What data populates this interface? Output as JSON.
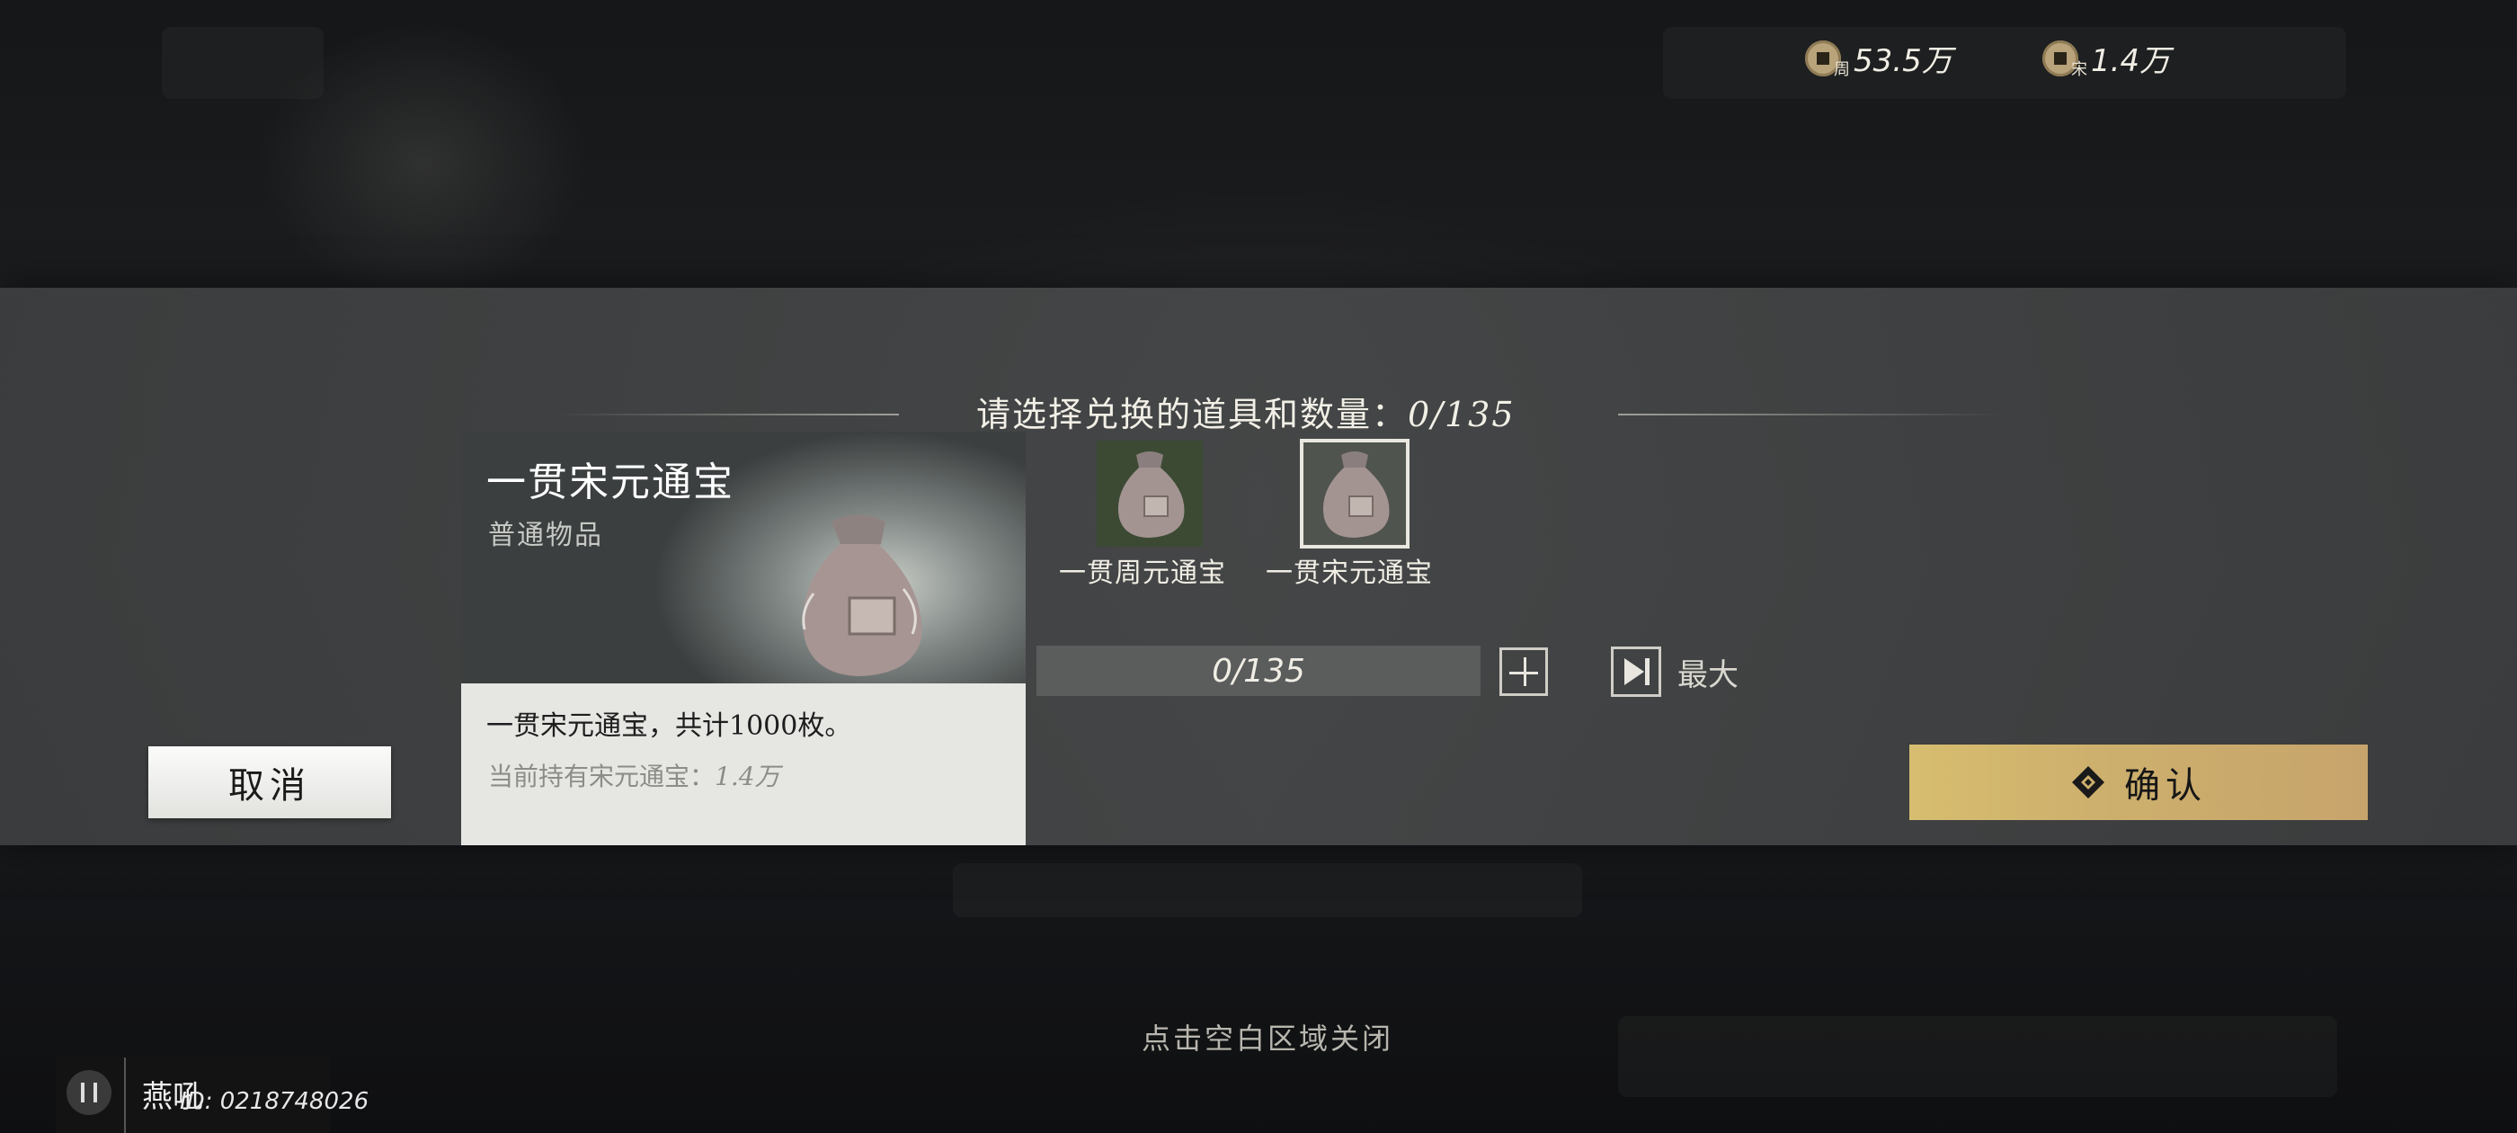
{
  "currencies": [
    {
      "icon": "zhou-coin-icon",
      "badge": "周",
      "amount": "53.5万"
    },
    {
      "icon": "song-coin-icon",
      "badge": "宋",
      "amount": "1.4万"
    }
  ],
  "dialog": {
    "title_prefix": "请选择兑换的道具和数量：",
    "title_count": "0/135",
    "item_card": {
      "name": "一贯宋元通宝",
      "rarity": "普通物品",
      "description": "一贯宋元通宝，共计1000枚。",
      "owned_label": "当前持有宋元通宝：",
      "owned_value": "1.4万"
    },
    "options": [
      {
        "label": "一贯周元通宝",
        "selected": false,
        "icon": "coin-pouch-icon"
      },
      {
        "label": "一贯宋元通宝",
        "selected": true,
        "icon": "coin-pouch-icon"
      }
    ],
    "quantity": "0/135",
    "max_label": "最大",
    "cancel_label": "取消",
    "confirm_label": "确认",
    "close_hint": "点击空白区域关闭"
  },
  "player": {
    "name": "燕吼",
    "id_text": "ID: 0218748026"
  },
  "colors": {
    "confirm_gold": "#cdb06d",
    "selected_outline": "#e9e7df"
  }
}
